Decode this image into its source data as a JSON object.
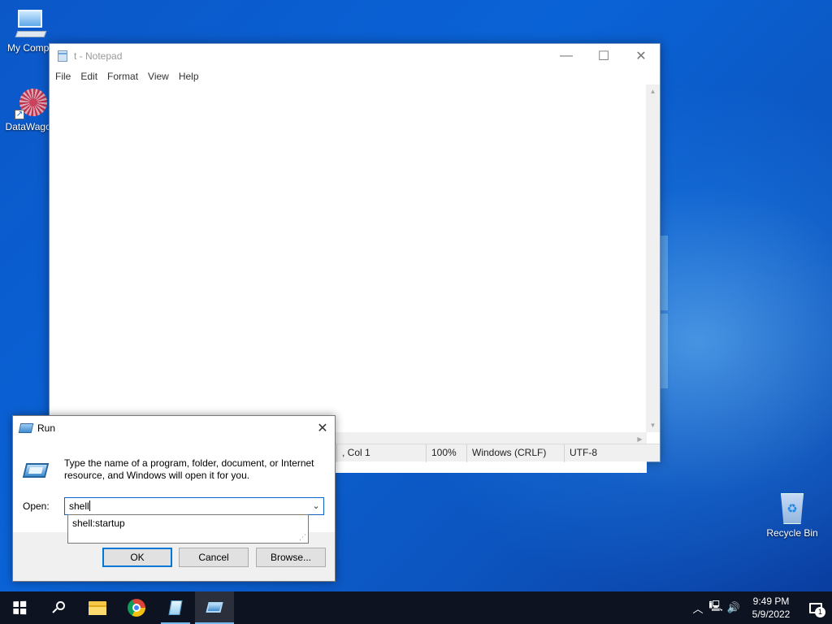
{
  "desktop": {
    "icons": [
      {
        "label": "My Compu",
        "icon": "computer-icon"
      },
      {
        "label": "DataWagon",
        "icon": "datawagon-shortcut-icon"
      },
      {
        "label": "Recycle Bin",
        "icon": "recycle-bin-icon"
      }
    ],
    "datawagon_shortcut_glyph": "↗",
    "recycle_glyph": "♻"
  },
  "notepad": {
    "title": "t - Notepad",
    "controls": {
      "minimize": "—",
      "maximize": "☐",
      "close": "✕"
    },
    "menu": [
      "File",
      "Edit",
      "Format",
      "View",
      "Help"
    ],
    "scroll": {
      "up": "▲",
      "down": "▼",
      "right": "▶"
    },
    "status": {
      "position": ", Col 1",
      "zoom": "100%",
      "line_ending": "Windows (CRLF)",
      "encoding": "UTF-8"
    }
  },
  "run_dialog": {
    "title": "Run",
    "close": "✕",
    "description": "Type the name of a program, folder, document, or Internet resource, and Windows will open it for you.",
    "open_label": "Open:",
    "input_value": "shell",
    "dropdown_glyph": "⌄",
    "autocomplete": [
      "shell:startup"
    ],
    "grip_glyph": "⋰",
    "buttons": {
      "ok": "OK",
      "cancel": "Cancel",
      "browse": "Browse..."
    }
  },
  "taskbar": {
    "apps": [
      "start-icon",
      "search-icon",
      "file-explorer-icon",
      "chrome-icon",
      "notepad-icon",
      "run-icon"
    ],
    "tray": {
      "chevron": "︿",
      "network": "🖳",
      "volume": "🔊",
      "time": "9:49 PM",
      "date": "5/9/2022",
      "notification_count": "1"
    }
  },
  "colors": {
    "desktop_blue": "#0a5cc6",
    "taskbar": "#0d1320",
    "accent": "#0078d7"
  }
}
